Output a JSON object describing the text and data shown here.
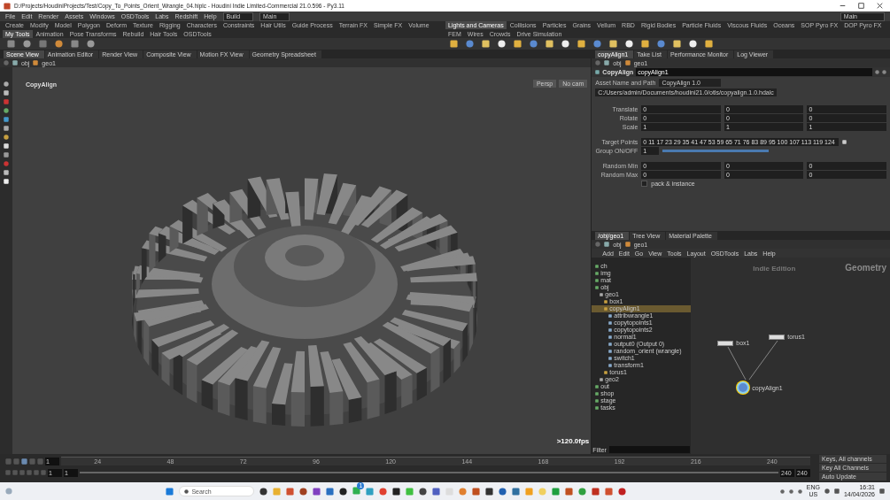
{
  "window": {
    "title": "D:/Projects/HoudiniProjects/Test/Copy_To_Points_Orient_Wrangle_04.hiplc - Houdini Indie Limited-Commercial 21.0.596 - Py3.11"
  },
  "menu": {
    "items": [
      "File",
      "Edit",
      "Render",
      "Assets",
      "Windows",
      "OSDTools",
      "Labs",
      "Redshift",
      "Help"
    ],
    "desktop": "Build",
    "layout": "Main",
    "right_desktop": "Main"
  },
  "shelf_tabs_left": [
    {
      "label": "Create",
      "selected": false
    },
    {
      "label": "Modify",
      "selected": false
    },
    {
      "label": "Model",
      "selected": false
    },
    {
      "label": "Polygon",
      "selected": false
    },
    {
      "label": "Deform",
      "selected": false
    },
    {
      "label": "Texture",
      "selected": false
    },
    {
      "label": "Rigging",
      "selected": false
    },
    {
      "label": "Characters",
      "selected": false
    },
    {
      "label": "Constraints",
      "selected": false
    },
    {
      "label": "Hair Utils",
      "selected": false
    },
    {
      "label": "Guide Process",
      "selected": false
    },
    {
      "label": "Terrain FX",
      "selected": false
    },
    {
      "label": "Simple FX",
      "selected": false
    },
    {
      "label": "Volume",
      "selected": false
    },
    {
      "label": "My Tools",
      "selected": true
    },
    {
      "label": "Animation",
      "selected": false
    },
    {
      "label": "Pose Transforms",
      "selected": false
    },
    {
      "label": "Rebuild",
      "selected": false
    },
    {
      "label": "Hair Tools",
      "selected": false
    },
    {
      "label": "OSDTools",
      "selected": false
    }
  ],
  "shelf_tabs_right": [
    {
      "label": "Lights and Cameras",
      "selected": true
    },
    {
      "label": "Collisions",
      "selected": false
    },
    {
      "label": "Particles",
      "selected": false
    },
    {
      "label": "Grains",
      "selected": false
    },
    {
      "label": "Vellum",
      "selected": false
    },
    {
      "label": "RBD",
      "selected": false
    },
    {
      "label": "Rigid Bodies",
      "selected": false
    },
    {
      "label": "Particle Fluids",
      "selected": false
    },
    {
      "label": "Viscous Fluids",
      "selected": false
    },
    {
      "label": "Oceans",
      "selected": false
    },
    {
      "label": "SOP Pyro FX",
      "selected": false
    },
    {
      "label": "DOP Pyro FX",
      "selected": false
    },
    {
      "label": "FEM",
      "selected": false
    },
    {
      "label": "Wires",
      "selected": false
    },
    {
      "label": "Crowds",
      "selected": false
    },
    {
      "label": "Drive Simulation",
      "selected": false
    }
  ],
  "pane_tabs_left": [
    {
      "label": "Scene View",
      "selected": true
    },
    {
      "label": "Animation Editor",
      "selected": false
    },
    {
      "label": "Render View",
      "selected": false
    },
    {
      "label": "Composite View",
      "selected": false
    },
    {
      "label": "Motion FX View",
      "selected": false
    },
    {
      "label": "Geometry Spreadsheet",
      "selected": false
    }
  ],
  "pane_tabs_right": [
    {
      "label": "copyAlign1",
      "selected": true
    },
    {
      "label": "Take List",
      "selected": false
    },
    {
      "label": "Performance Monitor",
      "selected": false
    },
    {
      "label": "Log Viewer",
      "selected": false
    }
  ],
  "viewport": {
    "path": [
      "obj",
      "geo1"
    ],
    "node_label": "CopyAlign",
    "camera": "Persp",
    "cam_menu": "No cam",
    "fps": ">120.0fps"
  },
  "parameters": {
    "path": [
      "obj",
      "geo1"
    ],
    "node_type": "CopyAlign",
    "node_name": "copyAlign1",
    "asset_label": "Asset Name and Path",
    "asset_name": "CopyAlign 1.0",
    "asset_path": "C:/Users/admin/Documents/houdini21.0/otls/copyalign.1.0.hdalc",
    "rows": [
      {
        "kind": "vector",
        "label": "Translate",
        "values": [
          "0",
          "0",
          "0"
        ]
      },
      {
        "kind": "vector",
        "label": "Rotate",
        "values": [
          "0",
          "0",
          "0"
        ]
      },
      {
        "kind": "vector",
        "label": "Scale",
        "values": [
          "1",
          "1",
          "1"
        ]
      },
      {
        "kind": "gap"
      },
      {
        "kind": "text",
        "label": "Target Points",
        "value": "0 11 17 23 29 35 41 47 53 59 65 71 76 83 89 95 100 107 113 119 124"
      },
      {
        "kind": "slider",
        "label": "Group ON/OFF",
        "value": "1",
        "level": 1
      },
      {
        "kind": "gap"
      },
      {
        "kind": "vector",
        "label": "Random Min",
        "values": [
          "0",
          "0",
          "0"
        ]
      },
      {
        "kind": "vector",
        "label": "Random Max",
        "values": [
          "0",
          "0",
          "0"
        ]
      },
      {
        "kind": "toggle",
        "label": "pack & instance",
        "checked": false
      }
    ]
  },
  "network": {
    "tabs": [
      {
        "label": "/obj/geo1",
        "selected": true
      },
      {
        "label": "Tree View",
        "selected": false
      },
      {
        "label": "Material Palette",
        "selected": false
      }
    ],
    "path": [
      "obj",
      "geo1"
    ],
    "menu": [
      "Add",
      "Edit",
      "Go",
      "View",
      "Tools",
      "Layout",
      "OSDTools",
      "Labs",
      "Help"
    ],
    "edition": "Indie Edition",
    "context": "Geometry",
    "tree": [
      {
        "label": "ch",
        "selected": false
      },
      {
        "label": "img",
        "selected": false
      },
      {
        "label": "mat",
        "selected": false
      },
      {
        "label": "obj",
        "selected": false,
        "children": [
          {
            "label": "geo1",
            "selected": false,
            "children": [
              {
                "label": "box1",
                "selected": false
              },
              {
                "label": "copyAlign1",
                "selected": true,
                "children": [
                  {
                    "label": "attribwrangle1",
                    "selected": false
                  },
                  {
                    "label": "copytopoints1",
                    "selected": false
                  },
                  {
                    "label": "copytopoints2",
                    "selected": false
                  },
                  {
                    "label": "normal1",
                    "selected": false
                  },
                  {
                    "label": "output0 (Output 0)",
                    "selected": false
                  },
                  {
                    "label": "random_orient (wrangle)",
                    "selected": false
                  },
                  {
                    "label": "switch1",
                    "selected": false
                  },
                  {
                    "label": "transform1",
                    "selected": false
                  }
                ]
              },
              {
                "label": "torus1",
                "selected": false
              }
            ]
          },
          {
            "label": "geo2",
            "selected": false
          }
        ]
      },
      {
        "label": "out",
        "selected": false
      },
      {
        "label": "shop",
        "selected": false
      },
      {
        "label": "stage",
        "selected": false
      },
      {
        "label": "tasks",
        "selected": false
      }
    ],
    "nodes": [
      {
        "name": "box1",
        "kind": "sop",
        "selected": false
      },
      {
        "name": "torus1",
        "kind": "sop",
        "selected": false
      },
      {
        "name": "copyAlign1",
        "kind": "hda",
        "selected": true
      }
    ],
    "filter_label": "Filter"
  },
  "timeline": {
    "frame": "1",
    "ticks": [
      "24",
      "48",
      "72",
      "96",
      "120",
      "144",
      "168",
      "192",
      "216",
      "240"
    ],
    "start": "1",
    "start2": "1",
    "end": "240",
    "end2": "240",
    "keys_menu": "Keys, All channels",
    "key_button": "Key All Channels",
    "update_menu": "Auto Update"
  },
  "taskbar": {
    "search_placeholder": "Search",
    "lang": "ENG",
    "region": "US",
    "time": "16:31",
    "date": "14/04/2026",
    "badge": "1"
  }
}
